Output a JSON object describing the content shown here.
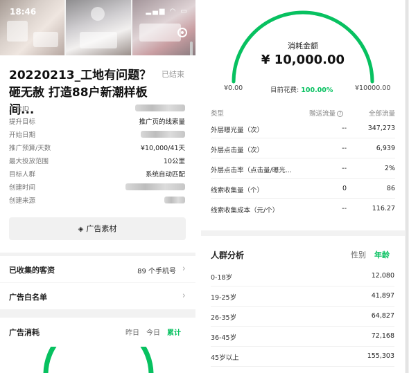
{
  "statusbar": {
    "time": "18:46"
  },
  "ad": {
    "title": "20220213_工地有问题？砸无赦 打造88户新潮样板间...",
    "status": "已结束",
    "info": [
      {
        "key": "广告ID",
        "value": ""
      },
      {
        "key": "提升目标",
        "value": "推广页的线索量"
      },
      {
        "key": "开始日期",
        "value": ""
      },
      {
        "key": "推广预算/天数",
        "value": "¥10,000/41天"
      },
      {
        "key": "最大投放范围",
        "value": "10公里"
      },
      {
        "key": "目标人群",
        "value": "系统自动匹配"
      },
      {
        "key": "创建时间",
        "value": ""
      },
      {
        "key": "创建来源",
        "value": ""
      }
    ],
    "material_button": "广告素材"
  },
  "customers": {
    "label": "已收集的客资",
    "value": "89 个手机号"
  },
  "whitelist": {
    "label": "广告白名单"
  },
  "spend": {
    "title": "广告消耗",
    "tabs": [
      "昨日",
      "今日",
      "累计"
    ],
    "active_tab": "累计"
  },
  "gauge": {
    "label": "消耗金额",
    "amount": "¥ 10,000.00",
    "min": "¥0.00",
    "max": "¥10000.00",
    "spent_label": "目前花费:",
    "spent_pct": "100.00%",
    "fraction": 1.0,
    "color": "#07c160"
  },
  "metrics": {
    "headers": {
      "type": "类型",
      "gift": "赠送流量",
      "total": "全部流量"
    },
    "rows": [
      {
        "name": "外层曝光量（次）",
        "gift": "--",
        "total": "347,273"
      },
      {
        "name": "外层点击量（次）",
        "gift": "--",
        "total": "6,939"
      },
      {
        "name": "外层点击率（点击量/曝光...",
        "gift": "--",
        "total": "2%"
      },
      {
        "name": "线索收集量（个）",
        "gift": "0",
        "total": "86"
      },
      {
        "name": "线索收集成本（元/个）",
        "gift": "--",
        "total": "116.27"
      }
    ]
  },
  "audience": {
    "title": "人群分析",
    "tabs": [
      "性别",
      "年龄"
    ],
    "active_tab": "年龄",
    "rows": [
      {
        "range": "0-18岁",
        "value": "12,080"
      },
      {
        "range": "19-25岁",
        "value": "41,897"
      },
      {
        "range": "26-35岁",
        "value": "64,827"
      },
      {
        "range": "36-45岁",
        "value": "72,168"
      },
      {
        "range": "45岁以上",
        "value": "155,303"
      }
    ]
  }
}
